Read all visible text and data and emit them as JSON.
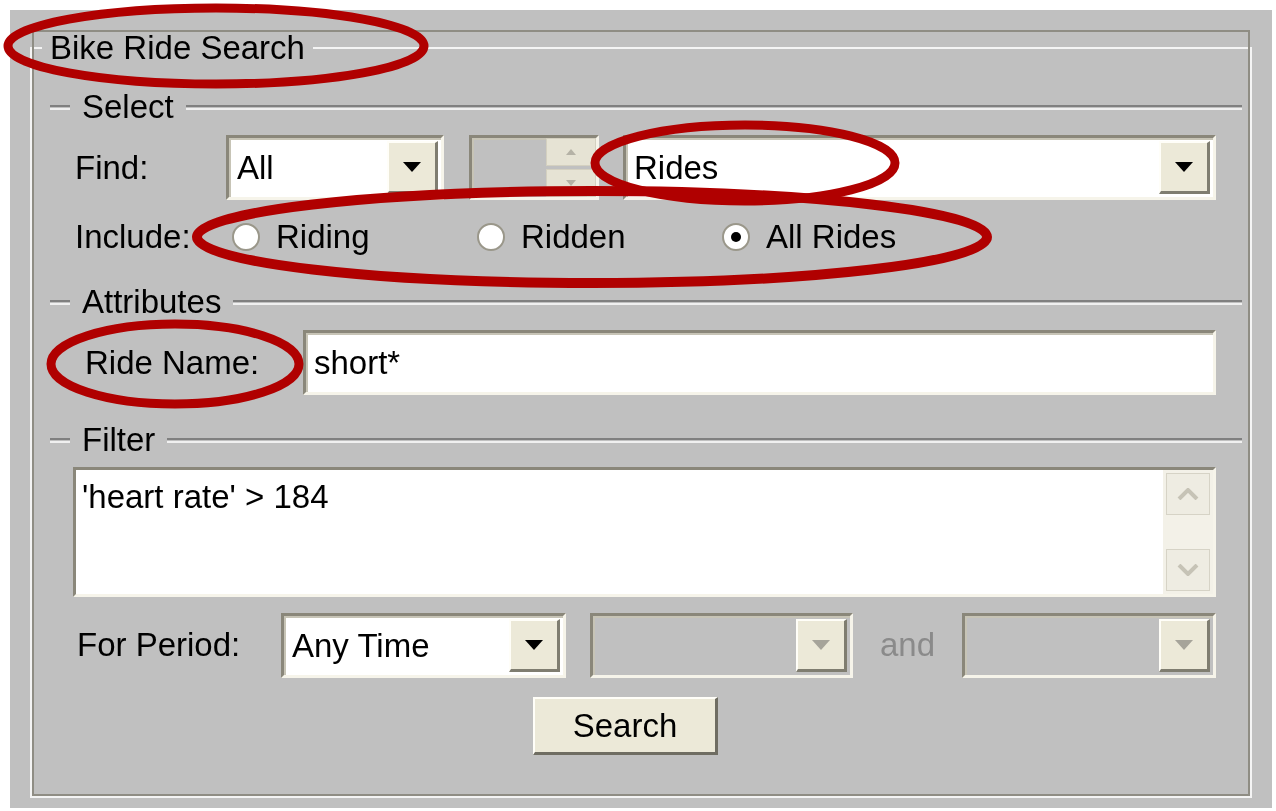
{
  "group_title": "Bike Ride Search",
  "select": {
    "heading": "Select",
    "find": {
      "label": "Find:",
      "scope": "All",
      "count": {
        "disabled": true
      },
      "type": "Rides"
    },
    "include": {
      "label": "Include:",
      "options": [
        {
          "label": "Riding",
          "selected": false
        },
        {
          "label": "Ridden",
          "selected": false
        },
        {
          "label": "All Rides",
          "selected": true
        }
      ]
    }
  },
  "attributes": {
    "heading": "Attributes",
    "ride_name": {
      "label": "Ride Name:",
      "value": "short*"
    }
  },
  "filter": {
    "heading": "Filter",
    "expression": "'heart rate' > 184",
    "period": {
      "label": "For Period:",
      "value": "Any Time",
      "from": {
        "disabled": true
      },
      "conjunction": "and",
      "to": {
        "disabled": true
      }
    }
  },
  "search_button": "Search"
}
